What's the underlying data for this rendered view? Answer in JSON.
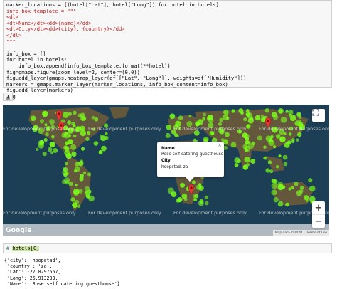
{
  "code_cell": {
    "lines": [
      "marker_locations = [(hotel[\"Lat\"], hotel[\"Long\"]) for hotel in hotels]",
      "info_box_template = \"\"\"",
      "<dl>",
      "<dt>Name</dt><dd>{name}</dd>",
      "<dt>City</dt><dd>{city}, {country}</dd>",
      "</dl>",
      "\"\"\"",
      "info_box = []",
      "for hotel in hotels:",
      "    info_box.append(info_box_template.format(**hotel))",
      "fig=gmaps.figure(zoom_level=2, center=(0,0))",
      "fig.add_layer(gmaps.heatmap_layer(df[[\"Lat\", \"Long\"]], weights=df[\"Humidity\"]))",
      "markers = gmaps.marker_layer(marker_locations, info_box_content=info_box)",
      "fig.add_layer(markers)",
      "fig"
    ]
  },
  "download_icon": "download-icon",
  "map": {
    "watermark_text": "For development purposes only",
    "info_window": {
      "name_label": "Name",
      "name_value": "Rose self catering guesthouse",
      "city_label": "City",
      "city_value": "hoopstad, za",
      "close": "×"
    },
    "zoom_in": "+",
    "zoom_out": "−",
    "logo": "Google",
    "footer_data": "Map data ©2020",
    "footer_terms": "Terms of Use",
    "heat_color": "#7cff1a",
    "marker_color": "#e53935"
  },
  "input_cell": {
    "comment": "# ",
    "code": "hotels[0]"
  },
  "output_lines": [
    "{'city': 'hoopstad',",
    " 'country': 'za',",
    " 'Lat': -27.8297567,",
    " 'Long': 25.913233,",
    " 'Name': 'Rose self catering guesthouse'}"
  ]
}
